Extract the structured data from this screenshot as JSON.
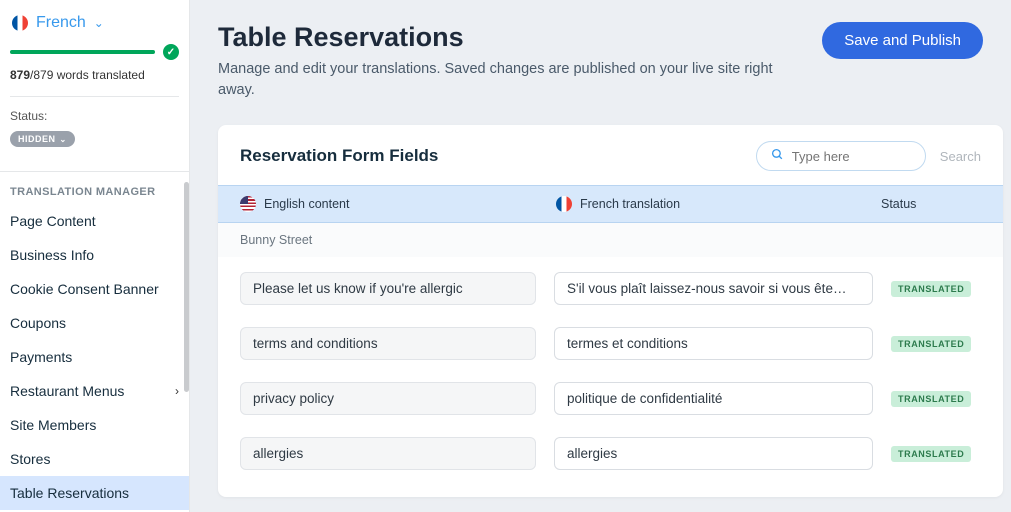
{
  "sidebar": {
    "language": "French",
    "words_done": "879",
    "words_total": "/879 words translated",
    "status_label": "Status:",
    "status_value": "HIDDEN",
    "section": "TRANSLATION MANAGER",
    "items": [
      {
        "label": "Page Content",
        "chevron": false,
        "active": false
      },
      {
        "label": "Business Info",
        "chevron": false,
        "active": false
      },
      {
        "label": "Cookie Consent Banner",
        "chevron": false,
        "active": false
      },
      {
        "label": "Coupons",
        "chevron": false,
        "active": false
      },
      {
        "label": "Payments",
        "chevron": false,
        "active": false
      },
      {
        "label": "Restaurant Menus",
        "chevron": true,
        "active": false
      },
      {
        "label": "Site Members",
        "chevron": false,
        "active": false
      },
      {
        "label": "Stores",
        "chevron": false,
        "active": false
      },
      {
        "label": "Table Reservations",
        "chevron": false,
        "active": true
      }
    ]
  },
  "header": {
    "title": "Table Reservations",
    "subtitle": "Manage and edit your translations. Saved changes are published on your live site right away.",
    "publish": "Save and Publish"
  },
  "card": {
    "title": "Reservation Form Fields",
    "search_placeholder": "Type here",
    "search_link": "Search",
    "cols": {
      "en": "English content",
      "fr": "French translation",
      "status": "Status"
    },
    "group": "Bunny Street",
    "badge": "TRANSLATED",
    "rows": [
      {
        "en": "Please let us know if you're allergic",
        "fr": "S'il vous plaît laissez-nous savoir si vous ête…"
      },
      {
        "en": "terms and conditions",
        "fr": "termes et conditions"
      },
      {
        "en": "privacy policy",
        "fr": "politique de confidentialité"
      },
      {
        "en": "allergies",
        "fr": "allergies"
      }
    ]
  }
}
